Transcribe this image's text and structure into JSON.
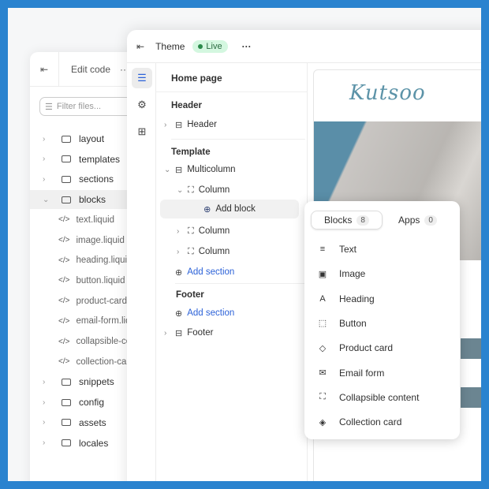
{
  "code_panel": {
    "title": "Edit code",
    "more": "···",
    "filter_placeholder": "Filter files...",
    "folders_top": [
      "layout",
      "templates",
      "sections",
      "blocks"
    ],
    "files": [
      "text.liquid",
      "image.liquid",
      "heading.liquid",
      "button.liquid",
      "product-card.liquid",
      "email-form.liquid",
      "collapsible-content.liquid",
      "collection-card.liquid"
    ],
    "folders_bottom": [
      "snippets",
      "config",
      "assets",
      "locales"
    ]
  },
  "theme": {
    "title": "Theme",
    "status": "Live",
    "more": "···",
    "page": "Home page",
    "header_group": "Header",
    "header_item": "Header",
    "template_group": "Template",
    "multicolumn": "Multicolumn",
    "column": "Column",
    "add_block": "Add block",
    "add_section": "Add section",
    "footer_group": "Footer",
    "footer_item": "Footer"
  },
  "preview": {
    "logo": "Kutsoo"
  },
  "popup": {
    "tabs": [
      {
        "label": "Blocks",
        "count": "8"
      },
      {
        "label": "Apps",
        "count": "0"
      }
    ],
    "items": [
      {
        "label": "Text",
        "icon": "≡"
      },
      {
        "label": "Image",
        "icon": "▣"
      },
      {
        "label": "Heading",
        "icon": "A"
      },
      {
        "label": "Button",
        "icon": "⬚"
      },
      {
        "label": "Product card",
        "icon": "◇"
      },
      {
        "label": "Email form",
        "icon": "✉"
      },
      {
        "label": "Collapsible content",
        "icon": "⛶"
      },
      {
        "label": "Collection card",
        "icon": "◈"
      }
    ]
  },
  "colors": {
    "frame": "#2a83cf",
    "accent": "#2c62d8",
    "live_bg": "#d4f7e0"
  }
}
